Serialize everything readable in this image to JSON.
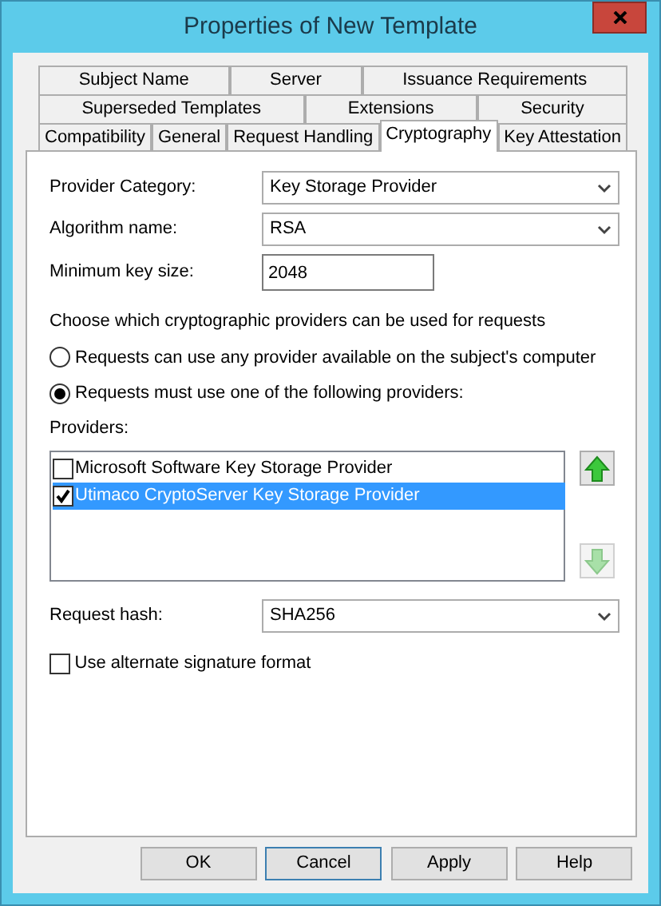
{
  "window": {
    "title": "Properties of New Template"
  },
  "tab_rows": [
    [
      {
        "label": "Subject Name",
        "selected": false
      },
      {
        "label": "Server",
        "selected": false
      },
      {
        "label": "Issuance Requirements",
        "selected": false
      }
    ],
    [
      {
        "label": "Superseded Templates",
        "selected": false
      },
      {
        "label": "Extensions",
        "selected": false
      },
      {
        "label": "Security",
        "selected": false
      }
    ],
    [
      {
        "label": "Compatibility",
        "selected": false
      },
      {
        "label": "General",
        "selected": false
      },
      {
        "label": "Request Handling",
        "selected": false
      },
      {
        "label": "Cryptography",
        "selected": true
      },
      {
        "label": "Key Attestation",
        "selected": false
      }
    ]
  ],
  "fields": [
    {
      "kind": "select",
      "label": "Provider Category:",
      "value": "Key Storage Provider"
    },
    {
      "kind": "select",
      "label": "Algorithm name:",
      "value": "RSA"
    },
    {
      "kind": "text",
      "label": "Minimum key size:",
      "value": "2048"
    }
  ],
  "provider_choice": {
    "prompt": "Choose which cryptographic providers can be used for requests",
    "options": [
      {
        "label": "Requests can use any provider available on the subject's computer",
        "selected": false
      },
      {
        "label": "Requests must use one of the following providers:",
        "selected": true
      }
    ]
  },
  "providers": {
    "label": "Providers:",
    "items": [
      {
        "label": "Microsoft Software Key Storage Provider",
        "checked": false,
        "selected": false
      },
      {
        "label": "Utimaco CryptoServer Key Storage Provider",
        "checked": true,
        "selected": true
      }
    ],
    "move_up": {
      "disabled": false
    },
    "move_down": {
      "disabled": true
    }
  },
  "request_hash": {
    "label": "Request hash:",
    "value": "SHA256"
  },
  "alternate_signature": {
    "label": "Use alternate signature format",
    "checked": false
  },
  "buttons": [
    {
      "label": "OK",
      "focused": false
    },
    {
      "label": "Cancel",
      "focused": true
    },
    {
      "label": "Apply",
      "focused": false
    },
    {
      "label": "Help",
      "focused": false
    }
  ]
}
